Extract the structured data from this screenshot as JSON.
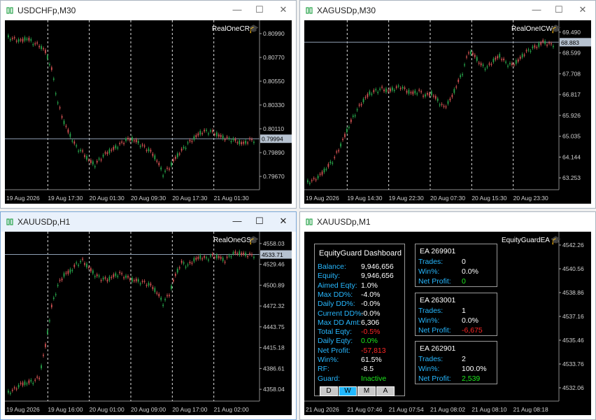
{
  "colors": {
    "up": "#27a44a",
    "down": "#d45353",
    "text": "#ffffff",
    "axis": "#d0d0d0",
    "price_tag_bg": "#b6c2d0",
    "grid_line": "#808080",
    "dash_blue": "#27b8ff",
    "dash_green": "#1de91d",
    "dash_red": "#ff2626"
  },
  "windows": [
    {
      "title": "USDCHFp,M30",
      "ea": "RealOneCR",
      "price_ticks": [
        "0.80990",
        "0.80770",
        "0.80550",
        "0.80330",
        "0.80110",
        "0.79890",
        "0.79670"
      ],
      "current_price": "0.79994",
      "time_ticks": [
        "19 Aug 2026",
        "19 Aug 17:30",
        "20 Aug 01:30",
        "20 Aug 09:30",
        "20 Aug 17:30",
        "21 Aug 01:30"
      ],
      "series": [
        0.8114,
        0.8112,
        0.811,
        0.8113,
        0.8108,
        0.8105,
        0.8098,
        0.8078,
        0.804,
        0.8018,
        0.8003,
        0.799,
        0.7984,
        0.7975,
        0.797,
        0.7978,
        0.7984,
        0.7988,
        0.7993,
        0.7998,
        0.7999,
        0.7995,
        0.799,
        0.7985,
        0.7975,
        0.796,
        0.7967,
        0.7978,
        0.7986,
        0.7994,
        0.8,
        0.8006,
        0.8008,
        0.8007,
        0.8003,
        0.8,
        0.7999,
        0.7996,
        0.7994,
        0.7998
      ],
      "price_range": [
        0.7945,
        0.813
      ]
    },
    {
      "title": "XAGUSDp,M30",
      "ea": "RealOneICW",
      "price_ticks": [
        "69.490",
        "68.599",
        "67.708",
        "66.817",
        "65.926",
        "65.035",
        "64.144",
        "63.253"
      ],
      "current_price": "68.883",
      "time_ticks": [
        "19 Aug 2026",
        "19 Aug 14:30",
        "19 Aug 22:30",
        "20 Aug 07:30",
        "20 Aug 15:30",
        "20 Aug 23:30"
      ],
      "series": [
        62.9,
        63.0,
        63.2,
        63.5,
        63.8,
        64.3,
        64.9,
        65.5,
        66.0,
        66.4,
        66.7,
        66.8,
        66.9,
        66.8,
        66.9,
        67.0,
        66.8,
        66.7,
        66.8,
        66.6,
        66.7,
        66.4,
        66.1,
        66.4,
        67.0,
        67.6,
        68.5,
        68.3,
        67.9,
        67.8,
        68.1,
        68.3,
        68.0,
        67.9,
        68.1,
        68.4,
        68.6,
        68.7,
        68.9,
        68.8
      ],
      "price_range": [
        62.7,
        69.7
      ]
    },
    {
      "title": "XAUUSDp,H1",
      "ea": "RealOneGS",
      "price_ticks": [
        "4558.03",
        "4529.46",
        "4500.89",
        "4472.32",
        "4443.75",
        "4415.18",
        "4386.61",
        "4358.04"
      ],
      "current_price": "4533.71",
      "time_ticks": [
        "19 Aug 2026",
        "19 Aug 16:00",
        "20 Aug 01:00",
        "20 Aug 09:00",
        "20 Aug 17:00",
        "21 Aug 02:00"
      ],
      "series": [
        4338,
        4343,
        4350,
        4352,
        4354,
        4360,
        4405,
        4460,
        4490,
        4505,
        4510,
        4520,
        4525,
        4515,
        4505,
        4500,
        4498,
        4503,
        4507,
        4502,
        4498,
        4496,
        4494,
        4490,
        4480,
        4465,
        4478,
        4505,
        4522,
        4518,
        4526,
        4530,
        4528,
        4532,
        4530,
        4525,
        4534,
        4536,
        4534,
        4533
      ],
      "price_range": [
        4330,
        4562
      ]
    },
    {
      "title": "XAUUSDp,M1",
      "ea": "EquityGuardEA",
      "price_ticks": [
        "4542.26",
        "4540.56",
        "4538.86",
        "4537.16",
        "4535.46",
        "4533.76",
        "4532.06"
      ],
      "time_ticks": [
        "21 Aug 2026",
        "21 Aug 07:46",
        "21 Aug 07:54",
        "21 Aug 08:02",
        "21 Aug 08:10",
        "21 Aug 08:18"
      ]
    }
  ],
  "dashboard": {
    "title": "EquityGuard Dashboard",
    "rows": [
      {
        "label": "Balance:",
        "value": "9,946,656",
        "color": "white"
      },
      {
        "label": "Equity:",
        "value": "9,946,656",
        "color": "white"
      },
      {
        "label": "Aimed Eqty:",
        "value": "1.0%",
        "color": "white"
      },
      {
        "label": "Max DD%:",
        "value": "-4.0%",
        "color": "white"
      },
      {
        "label": "Daily DD%:",
        "value": "-0.0%",
        "color": "white"
      },
      {
        "label": "Current DD%:",
        "value": "-0.0%",
        "color": "white"
      },
      {
        "label": "Max DD Amt:",
        "value": "6,306",
        "color": "white"
      },
      {
        "label": "Total Eqty:",
        "value": "-0.5%",
        "color": "red"
      },
      {
        "label": "Daily Eqty:",
        "value": "0.0%",
        "color": "green"
      },
      {
        "label": "Net Profit:",
        "value": "-57,813",
        "color": "red"
      },
      {
        "label": "Win%:",
        "value": "61.5%",
        "color": "white"
      },
      {
        "label": "RF:",
        "value": "-8.5",
        "color": "white"
      },
      {
        "label": "Guard:",
        "value": "Inactive",
        "color": "green"
      }
    ],
    "buttons": [
      "D",
      "W",
      "M",
      "A"
    ],
    "active_button": "W"
  },
  "ea_panels": [
    {
      "title": "EA 269901",
      "trades_label": "Trades:",
      "trades": "0",
      "win_label": "Win%:",
      "win": "0.0%",
      "profit_label": "Net Profit:",
      "profit": "0",
      "profit_color": "green"
    },
    {
      "title": "EA 263001",
      "trades_label": "Trades:",
      "trades": "1",
      "win_label": "Win%:",
      "win": "0.0%",
      "profit_label": "Net Profit:",
      "profit": "-6,675",
      "profit_color": "red"
    },
    {
      "title": "EA 262901",
      "trades_label": "Trades:",
      "trades": "2",
      "win_label": "Win%:",
      "win": "100.0%",
      "profit_label": "Net Profit:",
      "profit": "2,539",
      "profit_color": "green"
    }
  ]
}
